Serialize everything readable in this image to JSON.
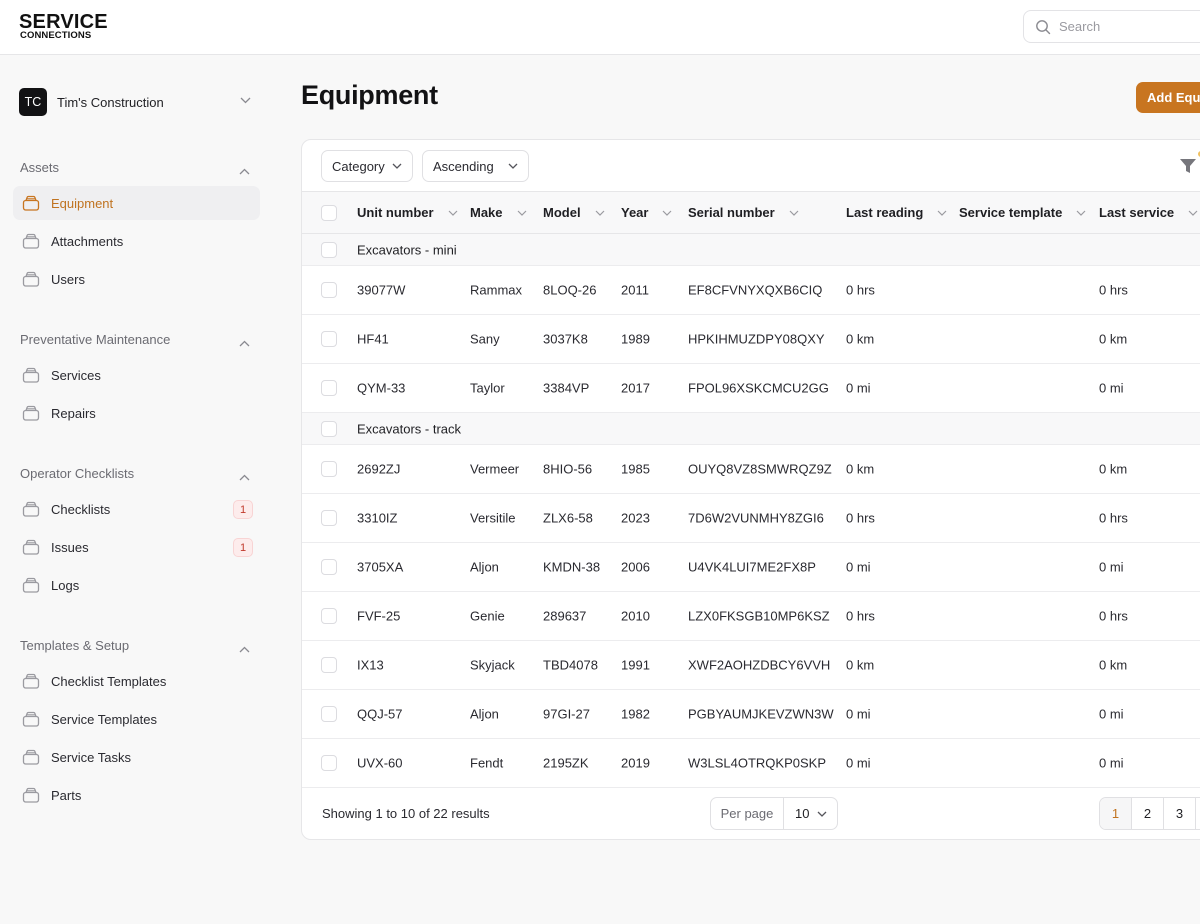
{
  "brand": {
    "line1": "SERVICE",
    "line2": "CONNECTIONS"
  },
  "search": {
    "placeholder": "Search",
    "value": ""
  },
  "org": {
    "initials": "TC",
    "name": "Tim's Construction"
  },
  "sidebar": {
    "sections": [
      {
        "title": "Assets",
        "items": [
          {
            "label": "Equipment",
            "active": true
          },
          {
            "label": "Attachments"
          },
          {
            "label": "Users"
          }
        ]
      },
      {
        "title": "Preventative Maintenance",
        "items": [
          {
            "label": "Services"
          },
          {
            "label": "Repairs"
          }
        ]
      },
      {
        "title": "Operator Checklists",
        "items": [
          {
            "label": "Checklists",
            "badge": "1"
          },
          {
            "label": "Issues",
            "badge": "1"
          },
          {
            "label": "Logs"
          }
        ]
      },
      {
        "title": "Templates & Setup",
        "items": [
          {
            "label": "Checklist Templates"
          },
          {
            "label": "Service Templates"
          },
          {
            "label": "Service Tasks"
          },
          {
            "label": "Parts"
          }
        ]
      }
    ]
  },
  "page": {
    "title": "Equipment",
    "add_button": "Add Equipment"
  },
  "toolbar": {
    "group_by": "Category",
    "sort_order": "Ascending"
  },
  "colors": {
    "accent": "#c87520",
    "badge_text": "#c0392b"
  },
  "table": {
    "columns": [
      "Unit number",
      "Make",
      "Model",
      "Year",
      "Serial number",
      "Last reading",
      "Service template",
      "Last service"
    ],
    "groups": [
      {
        "name": "Excavators - mini",
        "rows": [
          [
            "39077W",
            "Rammax",
            "8LOQ-26",
            "2011",
            "EF8CFVNYXQXB6CIQ",
            "0 hrs",
            "",
            "0 hrs"
          ],
          [
            "HF41",
            "Sany",
            "3037K8",
            "1989",
            "HPKIHMUZDPY08QXY",
            "0 km",
            "",
            "0 km"
          ],
          [
            "QYM-33",
            "Taylor",
            "3384VP",
            "2017",
            "FPOL96XSKCMCU2GG",
            "0 mi",
            "",
            "0 mi"
          ]
        ]
      },
      {
        "name": "Excavators - track",
        "rows": [
          [
            "2692ZJ",
            "Vermeer",
            "8HIO-56",
            "1985",
            "OUYQ8VZ8SMWRQZ9Z",
            "0 km",
            "",
            "0 km"
          ],
          [
            "3310IZ",
            "Versitile",
            "ZLX6-58",
            "2023",
            "7D6W2VUNMHY8ZGI6",
            "0 hrs",
            "",
            "0 hrs"
          ],
          [
            "3705XA",
            "Aljon",
            "KMDN-38",
            "2006",
            "U4VK4LUI7ME2FX8P",
            "0 mi",
            "",
            "0 mi"
          ],
          [
            "FVF-25",
            "Genie",
            "289637",
            "2010",
            "LZX0FKSGB10MP6KSZ",
            "0 hrs",
            "",
            "0 hrs"
          ],
          [
            "IX13",
            "Skyjack",
            "TBD4078",
            "1991",
            "XWF2AOHZDBCY6VVH",
            "0 km",
            "",
            "0 km"
          ],
          [
            "QQJ-57",
            "Aljon",
            "97GI-27",
            "1982",
            "PGBYAUMJKEVZWN3W",
            "0 mi",
            "",
            "0 mi"
          ],
          [
            "UVX-60",
            "Fendt",
            "2195ZK",
            "2019",
            "W3LSL4OTRQKP0SKP",
            "0 mi",
            "",
            "0 mi"
          ]
        ]
      }
    ]
  },
  "footer": {
    "showing": "Showing 1 to 10 of 22 results",
    "per_page_label": "Per page",
    "per_page_value": "10",
    "pages": [
      "1",
      "2",
      "3"
    ],
    "current_page": "1"
  }
}
